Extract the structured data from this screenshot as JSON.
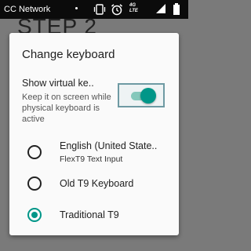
{
  "status_bar": {
    "carrier": "CC Network",
    "network_badge_top": "4G",
    "network_badge_bottom": "LTE",
    "icons": [
      "notification-dot",
      "vibrate-icon",
      "alarm-icon",
      "network-type-icon",
      "signal-icon",
      "battery-icon"
    ]
  },
  "background": {
    "heading": "STEP 2"
  },
  "dialog": {
    "title": "Change keyboard",
    "setting": {
      "title": "Show virtual ke..",
      "description": "Keep it on screen while physical keyboard is active",
      "toggle_on": true
    },
    "options": [
      {
        "label": "English (United State..",
        "sublabel": "FlexT9 Text Input",
        "selected": false
      },
      {
        "label": "Old T9 Keyboard",
        "sublabel": "",
        "selected": false
      },
      {
        "label": "Traditional T9",
        "sublabel": "",
        "selected": true
      }
    ]
  },
  "colors": {
    "accent": "#009688",
    "scrim": "#7a7a7a",
    "status_bar": "#0b0b0b",
    "dialog_background": "#fafafa"
  }
}
